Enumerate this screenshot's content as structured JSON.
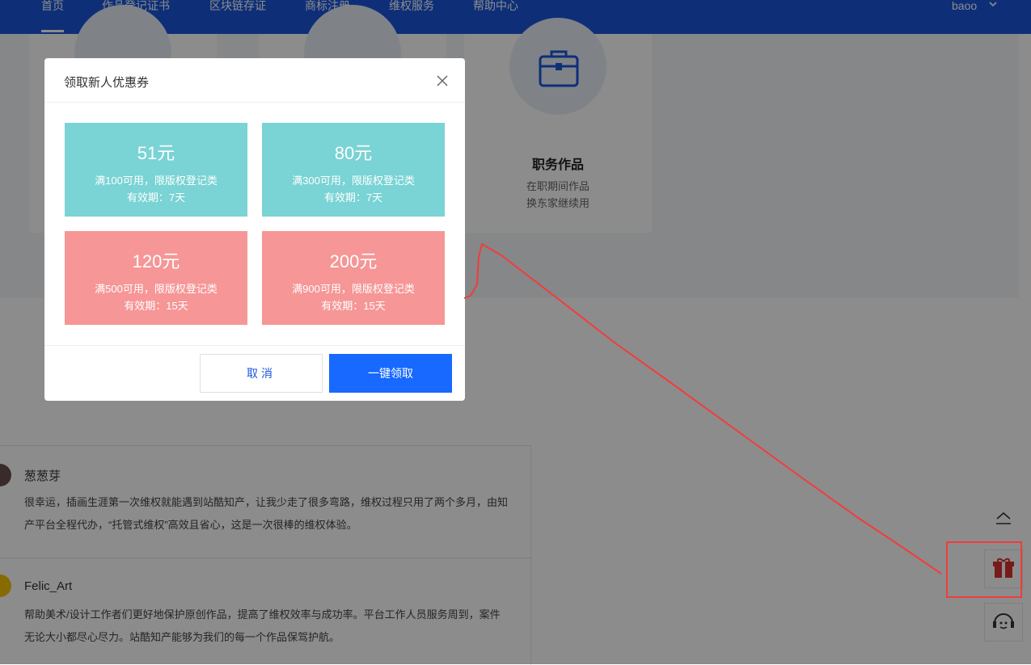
{
  "nav": {
    "items": [
      "首页",
      "作品登记证书",
      "区块链存证",
      "商标注册",
      "维权服务",
      "帮助中心"
    ],
    "user": "baoo"
  },
  "feature": {
    "title": "职务作品",
    "desc_line1": "在职期间作品",
    "desc_line2": "换东家继续用"
  },
  "reviews": [
    {
      "name": "葱葱芽",
      "text": "很幸运，插画生涯第一次维权就能遇到站酷知产，让我少走了很多弯路，维权过程只用了两个多月，由知产平台全程代办，“托管式维权”高效且省心，这是一次很棒的维权体验。"
    },
    {
      "name": "Felic_Art",
      "text": "帮助美术/设计工作者们更好地保护原创作品，提高了维权效率与成功率。平台工作人员服务周到，案件无论大小都尽心尽力。站酷知产能够为我们的每一个作品保驾护航。"
    }
  ],
  "modal": {
    "title": "领取新人优惠券",
    "coupons": [
      {
        "amount": "51元",
        "condition": "满100可用，限版权登记类",
        "validity": "有效期：7天",
        "color": "#7ad3d4"
      },
      {
        "amount": "80元",
        "condition": "满300可用，限版权登记类",
        "validity": "有效期：7天",
        "color": "#7ad3d4"
      },
      {
        "amount": "120元",
        "condition": "满500可用，限版权登记类",
        "validity": "有效期：15天",
        "color": "#f69696"
      },
      {
        "amount": "200元",
        "condition": "满900可用，限版权登记类",
        "validity": "有效期：15天",
        "color": "#f69696"
      }
    ],
    "cancel_label": "取消",
    "claim_label": "一键领取"
  },
  "colors": {
    "nav_bg": "#1a56db",
    "primary_button": "#1769ff",
    "annotation": "#f23c3c"
  },
  "side_icons": [
    "arrow-up-icon",
    "gift-icon",
    "customer-service-icon"
  ]
}
